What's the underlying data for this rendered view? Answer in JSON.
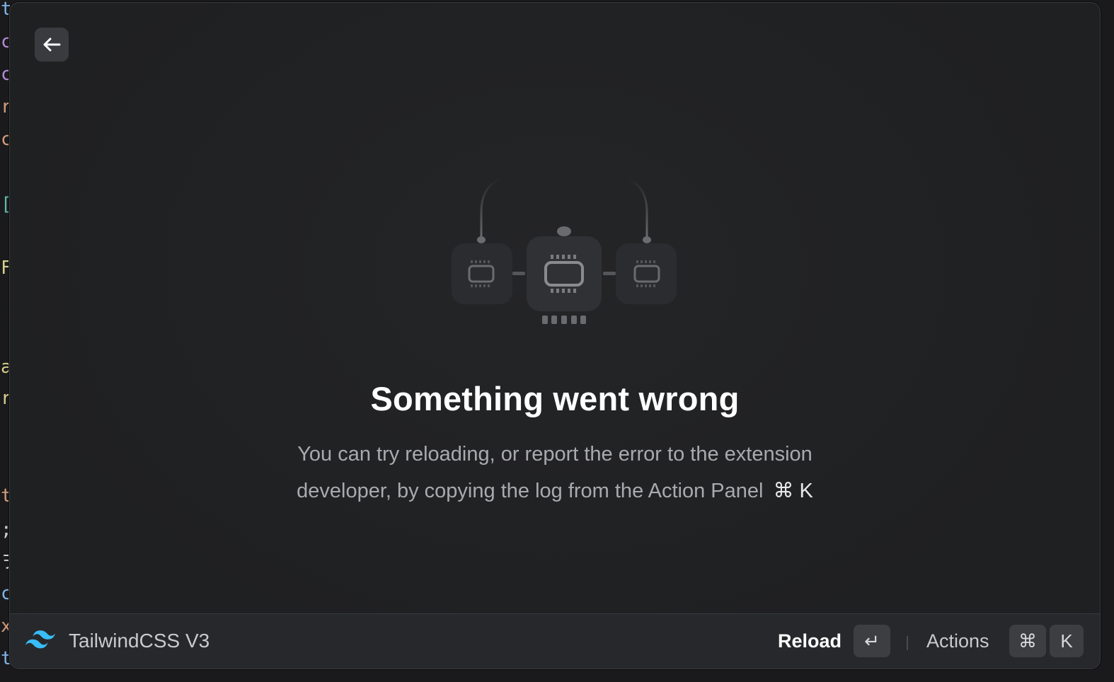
{
  "header": {
    "back_icon": "arrow-left-icon"
  },
  "error": {
    "title": "Something went wrong",
    "message_line1": "You can try reloading, or report the error to the extension",
    "message_line2": "developer, by copying the log from the Action Panel",
    "shortcut": "⌘ K",
    "illustration_icon": "circuit-chips-icon"
  },
  "footer": {
    "extension_icon": "tailwindcss-logo-icon",
    "extension_name": "TailwindCSS V3",
    "reload_label": "Reload",
    "reload_key": "↵",
    "actions_label": "Actions",
    "actions_key_modifier": "⌘",
    "actions_key": "K"
  },
  "background_code_glyphs": [
    "t",
    "c",
    "c",
    "r",
    "c",
    "[",
    "F",
    "a",
    "r",
    "t",
    ";",
    "ヲ",
    "c",
    "x",
    "t"
  ],
  "colors": {
    "accent": "#38bdf8",
    "window_bg": "#202123",
    "footer_bg": "#27282b",
    "title_text": "#ffffff",
    "muted_text": "#a9aaad"
  }
}
